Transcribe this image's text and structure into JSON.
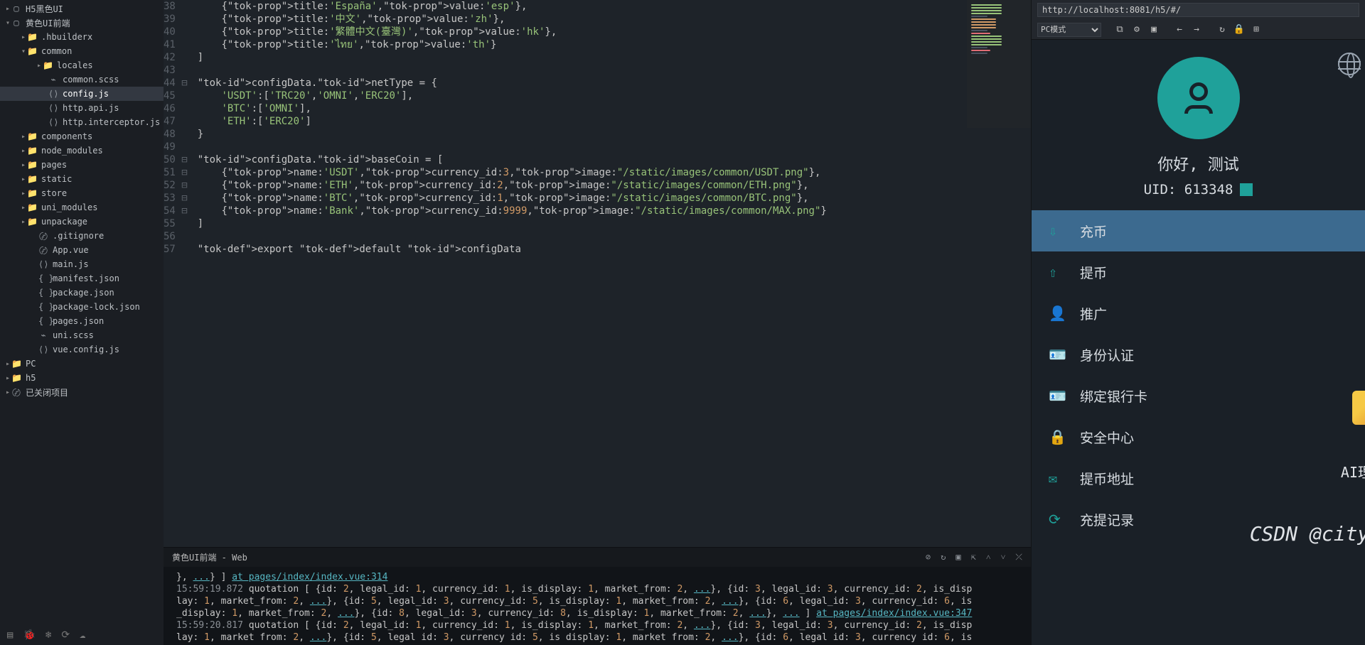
{
  "tree": [
    {
      "pad": 6,
      "chev": "▸",
      "icon": "▢",
      "label": "H5黑色UI"
    },
    {
      "pad": 6,
      "chev": "▾",
      "icon": "▢",
      "label": "黄色UI前端"
    },
    {
      "pad": 28,
      "chev": "▸",
      "icon": "📁",
      "label": ".hbuilderx"
    },
    {
      "pad": 28,
      "chev": "▾",
      "icon": "📁",
      "label": "common"
    },
    {
      "pad": 50,
      "chev": "▸",
      "icon": "📁",
      "label": "locales"
    },
    {
      "pad": 58,
      "chev": "",
      "icon": "⌁",
      "label": "common.scss"
    },
    {
      "pad": 58,
      "chev": "",
      "icon": "⟨⟩",
      "label": "config.js",
      "active": true
    },
    {
      "pad": 58,
      "chev": "",
      "icon": "⟨⟩",
      "label": "http.api.js"
    },
    {
      "pad": 58,
      "chev": "",
      "icon": "⟨⟩",
      "label": "http.interceptor.js"
    },
    {
      "pad": 28,
      "chev": "▸",
      "icon": "📁",
      "label": "components"
    },
    {
      "pad": 28,
      "chev": "▸",
      "icon": "📁",
      "label": "node_modules"
    },
    {
      "pad": 28,
      "chev": "▸",
      "icon": "📁",
      "label": "pages"
    },
    {
      "pad": 28,
      "chev": "▸",
      "icon": "📁",
      "label": "static"
    },
    {
      "pad": 28,
      "chev": "▸",
      "icon": "📁",
      "label": "store"
    },
    {
      "pad": 28,
      "chev": "▸",
      "icon": "📁",
      "label": "uni_modules"
    },
    {
      "pad": 28,
      "chev": "▸",
      "icon": "📁",
      "label": "unpackage"
    },
    {
      "pad": 44,
      "chev": "",
      "icon": "〄",
      "label": ".gitignore"
    },
    {
      "pad": 44,
      "chev": "",
      "icon": "〄",
      "label": "App.vue"
    },
    {
      "pad": 44,
      "chev": "",
      "icon": "⟨⟩",
      "label": "main.js"
    },
    {
      "pad": 44,
      "chev": "",
      "icon": "{ }",
      "label": "manifest.json"
    },
    {
      "pad": 44,
      "chev": "",
      "icon": "{ }",
      "label": "package.json"
    },
    {
      "pad": 44,
      "chev": "",
      "icon": "{ }",
      "label": "package-lock.json"
    },
    {
      "pad": 44,
      "chev": "",
      "icon": "{ }",
      "label": "pages.json"
    },
    {
      "pad": 44,
      "chev": "",
      "icon": "⌁",
      "label": "uni.scss"
    },
    {
      "pad": 44,
      "chev": "",
      "icon": "⟨⟩",
      "label": "vue.config.js"
    },
    {
      "pad": 6,
      "chev": "▸",
      "icon": "📁",
      "label": "PC"
    },
    {
      "pad": 6,
      "chev": "▸",
      "icon": "📁",
      "label": "h5"
    },
    {
      "pad": 6,
      "chev": "▸",
      "icon": "〄",
      "label": "已关闭项目"
    }
  ],
  "code_start": 38,
  "code": [
    "    {title:'España',value:'esp'},",
    "    {title:'中文',value:'zh'},",
    "    {title:'繁體中文(臺灣)',value:'hk'},",
    "    {title:'ไทย',value:'th'}",
    "]",
    "",
    "configData.netType = {",
    "    'USDT':['TRC20','OMNI','ERC20'],",
    "    'BTC':['OMNI'],",
    "    'ETH':['ERC20']",
    "}",
    "",
    "configData.baseCoin = [",
    "    {name:'USDT',currency_id:3,image:\"/static/images/common/USDT.png\"},",
    "    {name:'ETH',currency_id:2,image:\"/static/images/common/ETH.png\"},",
    "    {name:'BTC',currency_id:1,image:\"/static/images/common/BTC.png\"},",
    "    {name:'Bank',currency_id:9999,image:\"/static/images/common/MAX.png\"}",
    "]",
    "",
    "export default configData"
  ],
  "fold_lines": [
    44,
    50,
    51,
    52,
    53,
    54
  ],
  "console_tab": "黄色UI前端 - Web",
  "console_lines": [
    {
      "pre": "}, ",
      "elps": "...",
      "post": "} ] ",
      "link": "at pages/index/index.vue:314"
    },
    {
      "ts": "15:59:19.872",
      "body": " quotation [ {id: 2, legal_id: 1, currency_id: 1, is_display: 1, market_from: 2, ...}, {id: 3, legal_id: 3, currency_id: 2, is_disp"
    },
    {
      "body": "lay: 1, market_from: 2, ...}, {id: 5, legal_id: 3, currency_id: 5, is_display: 1, market_from: 2, ...}, {id: 6, legal_id: 3, currency_id: 6, is"
    },
    {
      "body": "_display: 1, market_from: 2, ...}, {id: 8, legal_id: 3, currency_id: 8, is_display: 1, market_from: 2, ...}, ... ] ",
      "link": "at pages/index/index.vue:347"
    },
    {
      "ts": "15:59:20.817",
      "body": " quotation [ {id: 2, legal_id: 1, currency_id: 1, is_display: 1, market_from: 2, ...}, {id: 3, legal_id: 3, currency_id: 2, is_disp"
    },
    {
      "body": "lay: 1, market from: 2, ...}, {id: 5, legal id: 3, currency id: 5, is display: 1, market from: 2, ...}, {id: 6, legal id: 3, currency id: 6, is"
    }
  ],
  "url": "http://localhost:8081/h5/#/",
  "mode": "PC模式",
  "hello": "你好, 测试",
  "uid": "UID: 613348",
  "menu": [
    {
      "icon": "⇩",
      "label": "充币",
      "sel": true
    },
    {
      "icon": "⇧",
      "label": "提币"
    },
    {
      "icon": "👤",
      "label": "推广"
    },
    {
      "icon": "🪪",
      "label": "身份认证"
    },
    {
      "icon": "🪪",
      "label": "绑定银行卡"
    },
    {
      "icon": "🔒",
      "label": "安全中心"
    },
    {
      "icon": "✉",
      "label": "提币地址"
    },
    {
      "icon": "⟳",
      "label": "充提记录"
    }
  ],
  "watermark": "CSDN @cityll",
  "watermark2": "AI理财"
}
